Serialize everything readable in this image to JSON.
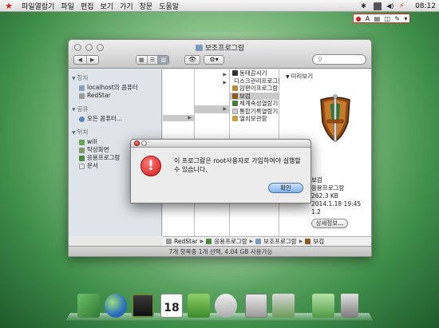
{
  "menubar": {
    "items": [
      "파일열람기",
      "파일",
      "편집",
      "보기",
      "가기",
      "창문",
      "도움말"
    ],
    "clock": "08:12"
  },
  "inputbar": {
    "label": "A"
  },
  "window": {
    "title": "보조프로그람",
    "search_placeholder": "",
    "sidebar": {
      "sections": [
        {
          "heading": "장치",
          "items": [
            "localhost의 콤퓨터",
            "RedStar"
          ]
        },
        {
          "heading": "공유",
          "items": [
            "모든 콤퓨터..."
          ]
        },
        {
          "heading": "위치",
          "items": [
            "will",
            "탁상화면",
            "응용프로그람",
            "문서"
          ]
        }
      ]
    },
    "col3_items": [
      "동태감시기",
      "디스크관리프로그람",
      "암편이프로그람",
      "보검",
      "체계속성열람기",
      "통합기록열람기",
      "열쇠보관함"
    ],
    "col3_selected": "보검",
    "preview": {
      "heading": "미리보기",
      "info": [
        "보검",
        "응용프로그람",
        "262.3 KB",
        "2014.1.18 19:45",
        "1.2"
      ],
      "more_button": "상세정보..."
    },
    "pathbar": [
      "RedStar",
      "응용프로그람",
      "보조프로그람",
      "보검"
    ],
    "status": "7개 항목중 1개 선택, 4.04 GB 사용가능"
  },
  "dialog": {
    "message": "이 프로그람은 root사용자로 가입하여야 실행할수 있습니다.",
    "ok_button": "확인"
  },
  "dock": {
    "date_tile": "18"
  },
  "colors": {
    "accent_red": "#d42020",
    "selection_gray": "#c9c9c9",
    "ok_blue": "#7fb1ea"
  }
}
